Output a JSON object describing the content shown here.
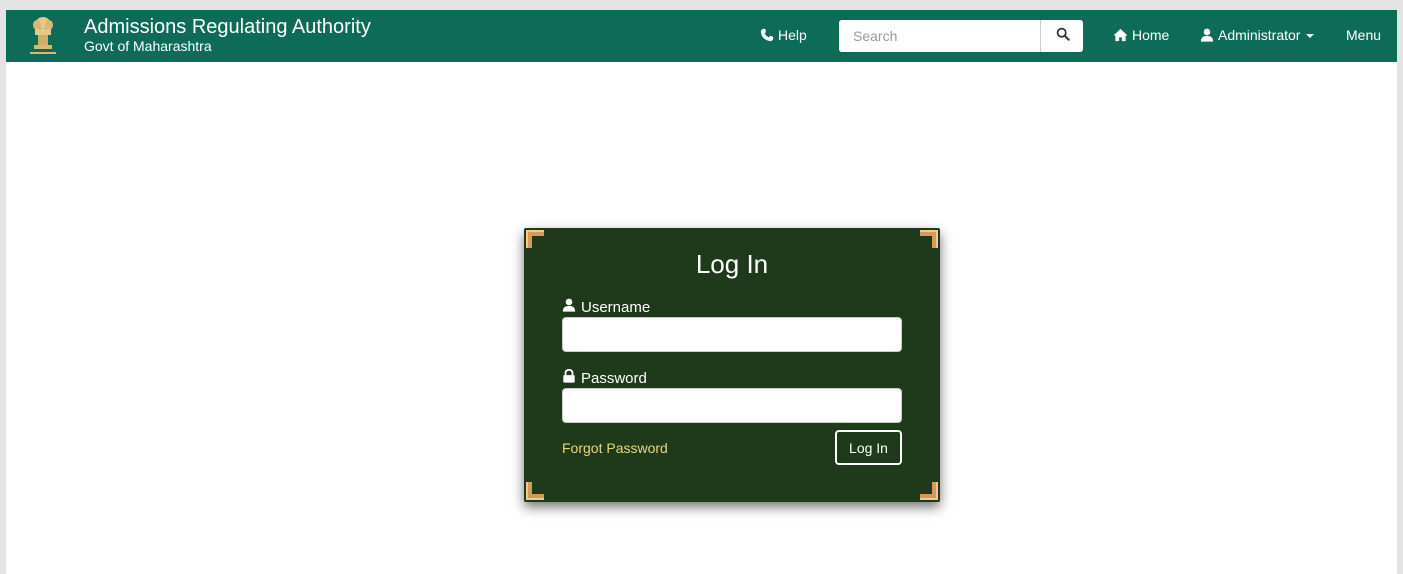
{
  "header": {
    "title": "Admissions Regulating Authority",
    "subtitle": "Govt of Maharashtra",
    "emblem_icon": "state-emblem-icon",
    "brand_color": "#0e6b57"
  },
  "nav": {
    "help": "Help",
    "home": "Home",
    "administrator": "Administrator",
    "menu": "Menu",
    "search_placeholder": "Search"
  },
  "login": {
    "title": "Log In",
    "username_label": "Username",
    "password_label": "Password",
    "username_value": "",
    "password_value": "",
    "forgot_label": "Forgot Password",
    "submit_label": "Log In",
    "card_color": "#1f3a1b",
    "link_color": "#e8d67a"
  }
}
